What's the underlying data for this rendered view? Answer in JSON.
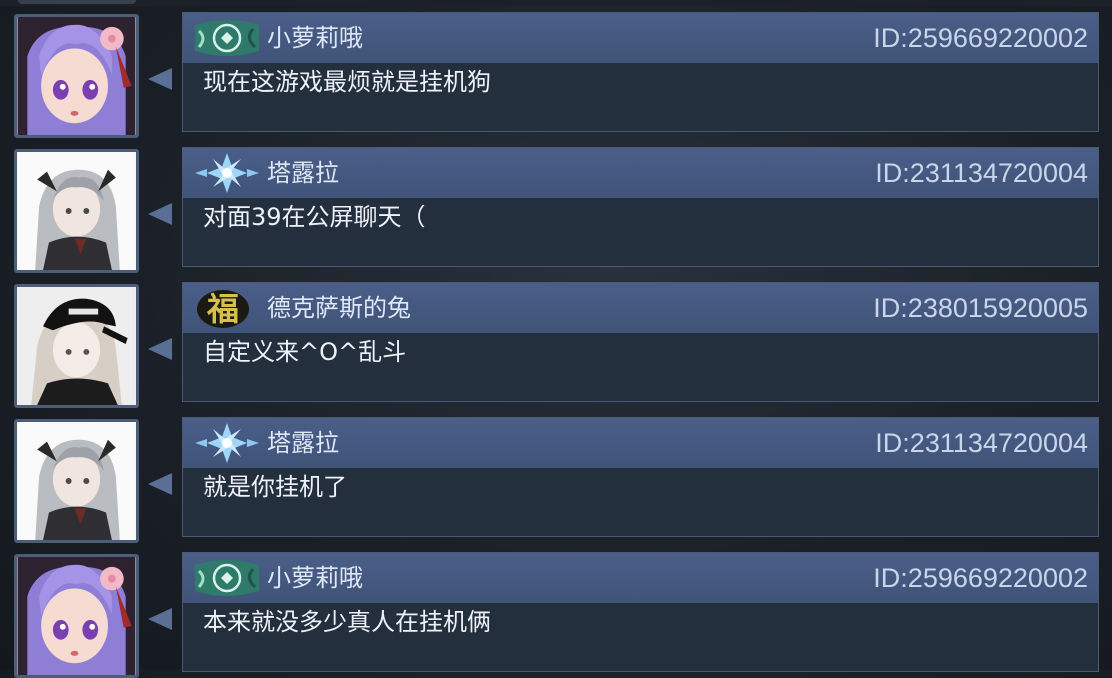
{
  "messages": [
    {
      "sender": "小萝莉哦",
      "user_id": "ID:259669220002",
      "text": "现在这游戏最烦就是挂机狗",
      "badge": "green-swirl-badge-icon",
      "avatar": "purple-hair-girl-avatar"
    },
    {
      "sender": "塔露拉",
      "user_id": "ID:231134720004",
      "text": "对面39在公屏聊天（",
      "badge": "blue-snowflake-badge-icon",
      "avatar": "silver-hair-horned-avatar"
    },
    {
      "sender": "德克萨斯的兔",
      "user_id": "ID:238015920005",
      "text": "自定义来^O^乱斗",
      "badge": "fu-character-badge-icon",
      "avatar": "black-cap-girl-avatar"
    },
    {
      "sender": "塔露拉",
      "user_id": "ID:231134720004",
      "text": "就是你挂机了",
      "badge": "blue-snowflake-badge-icon",
      "avatar": "silver-hair-horned-avatar"
    },
    {
      "sender": "小萝莉哦",
      "user_id": "ID:259669220002",
      "text": "本来就没多少真人在挂机俩",
      "badge": "green-swirl-badge-icon",
      "avatar": "purple-hair-girl-avatar"
    }
  ],
  "badges": {
    "fu_char": "福"
  },
  "colors": {
    "header": "#445a80",
    "card": "#242f3e",
    "border": "#4a5a74",
    "pointer": "#5a6f95"
  }
}
